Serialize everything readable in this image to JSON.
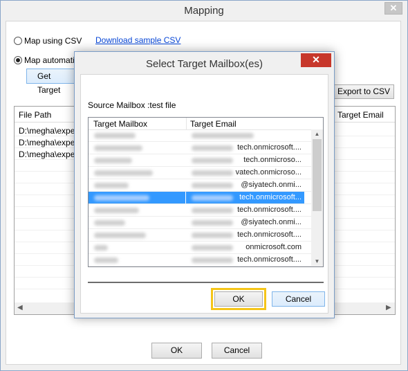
{
  "window": {
    "title": "Mapping",
    "close_glyph": "✕"
  },
  "options": {
    "map_csv_label": "Map using CSV",
    "download_csv_link": "Download sample CSV",
    "map_auto_label": "Map automatica",
    "get_target_button": "Get Target",
    "export_csv_button": "Export to CSV"
  },
  "background_table": {
    "columns": [
      "File Path",
      "Target Email"
    ],
    "rows": [
      "D:\\megha\\exper",
      "D:\\megha\\exper",
      "D:\\megha\\exper"
    ]
  },
  "footer": {
    "ok_label": "OK",
    "cancel_label": "Cancel"
  },
  "dialog": {
    "title": "Select Target Mailbox(es)",
    "close_glyph": "✕",
    "source_label": "Source Mailbox :test file",
    "columns": [
      "Target Mailbox",
      "Target Email"
    ],
    "rows": [
      {
        "email": ""
      },
      {
        "email": "tech.onmicrosoft...."
      },
      {
        "email": "tech.onmicroso..."
      },
      {
        "email": "vatech.onmicroso..."
      },
      {
        "email": "@siyatech.onmi..."
      },
      {
        "email": "tech.onmicrosoft...",
        "selected": true
      },
      {
        "email": "tech.onmicrosoft...."
      },
      {
        "email": "@siyatech.onmi..."
      },
      {
        "email": "tech.onmicrosoft...."
      },
      {
        "email": "onmicrosoft.com"
      },
      {
        "email": "tech.onmicrosoft...."
      },
      {
        "email": ""
      }
    ],
    "ok_label": "OK",
    "cancel_label": "Cancel"
  },
  "colors": {
    "selection": "#3399ff",
    "highlight": "#f5c518",
    "close_red": "#c7372b",
    "link": "#0645d6"
  }
}
